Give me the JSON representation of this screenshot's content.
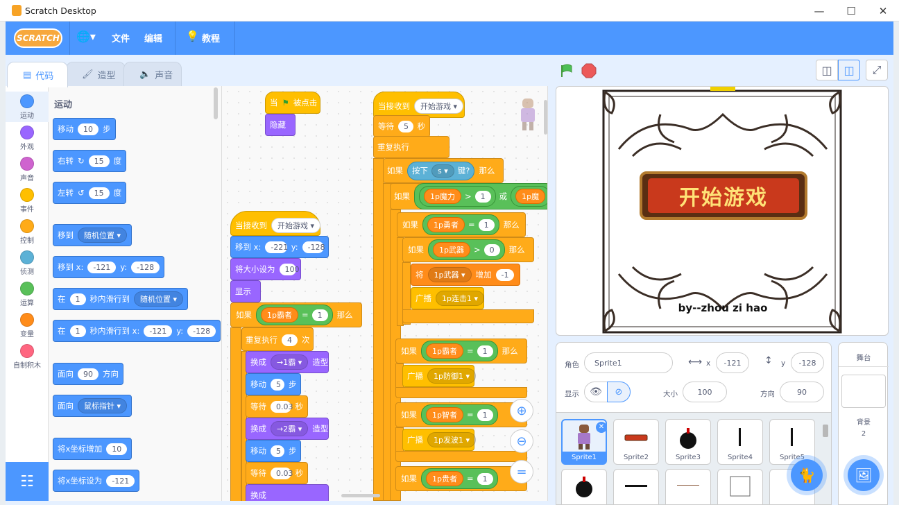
{
  "window": {
    "title": "Scratch Desktop"
  },
  "menu": {
    "logo": "SCRATCH",
    "file": "文件",
    "edit": "编辑",
    "tutorials": "教程"
  },
  "tabs": {
    "code": "代码",
    "costumes": "造型",
    "sounds": "声音"
  },
  "categories": [
    {
      "label": "运动",
      "color": "#4c97ff"
    },
    {
      "label": "外观",
      "color": "#9966ff"
    },
    {
      "label": "声音",
      "color": "#cf63cf"
    },
    {
      "label": "事件",
      "color": "#ffbf00"
    },
    {
      "label": "控制",
      "color": "#ffab19"
    },
    {
      "label": "侦测",
      "color": "#5cb1d6"
    },
    {
      "label": "运算",
      "color": "#59c059"
    },
    {
      "label": "变量",
      "color": "#ff8c1a"
    },
    {
      "label": "自制积木",
      "color": "#ff6680"
    }
  ],
  "palette": {
    "title": "运动",
    "move": {
      "a": "移动",
      "v": "10",
      "b": "步"
    },
    "turn_right": {
      "a": "右转",
      "v": "15",
      "b": "度"
    },
    "turn_left": {
      "a": "左转",
      "v": "15",
      "b": "度"
    },
    "goto": {
      "a": "移到",
      "d": "随机位置"
    },
    "goto_xy": {
      "a": "移到 x:",
      "x": "-121",
      "yl": "y:",
      "y": "-128"
    },
    "glide": {
      "a": "在",
      "v": "1",
      "b": "秒内滑行到",
      "d": "随机位置"
    },
    "glide_xy": {
      "a": "在",
      "v": "1",
      "b": "秒内滑行到 x:",
      "x": "-121",
      "yl": "y:",
      "y": "-128"
    },
    "point_dir": {
      "a": "面向",
      "v": "90",
      "b": "方向"
    },
    "point_towards": {
      "a": "面向",
      "d": "鼠标指针"
    },
    "change_x": {
      "a": "将x坐标增加",
      "v": "10"
    },
    "set_x": {
      "a": "将x坐标设为",
      "v": "-121"
    }
  },
  "script1": {
    "when": "当",
    "clicked": "被点击",
    "hide": "隐藏"
  },
  "script2": {
    "recv": "当接收到",
    "msg": "开始游戏",
    "goto": "移到 x:",
    "x": "-221",
    "yl": "y:",
    "y": "-128",
    "size": "将大小设为",
    "sizev": "100",
    "show": "显示",
    "if": "如果",
    "var": "1p霸者",
    "eq": "=",
    "val": "1",
    "then": "那么",
    "repeat": "重复执行",
    "times": "4",
    "ci": "次",
    "switch": "换成",
    "cost1": "→1霸",
    "cost2": "→2霸",
    "costlbl": "造型",
    "move": "移动",
    "movev": "5",
    "step": "步",
    "wait": "等待",
    "waitv": "0.03",
    "sec": "秒"
  },
  "script3": {
    "recv": "当接收到",
    "msg": "开始游戏",
    "wait": "等待",
    "waitv": "5",
    "sec": "秒",
    "forever": "重复执行",
    "if": "如果",
    "press": "按下",
    "key": "s",
    "keyq": "键?",
    "then": "那么",
    "mp": "1p魔力",
    "gt": ">",
    "one": "1",
    "or": "或",
    "mp2": "1p魔",
    "brave": "1p勇者",
    "eq": "=",
    "weapon": "1p武器",
    "zero": "0",
    "change": "将",
    "add": "增加",
    "neg1": "-1",
    "bcast": "广播",
    "combo": "1p连击1",
    "overlord": "1p霸者",
    "def": "1p防御1",
    "wise": "1p智者",
    "wave": "1p发波1",
    "noble": "1p贵者"
  },
  "stage": {
    "title": "开始游戏",
    "credit": "by--zhou zi hao"
  },
  "sprite_info": {
    "sprite_label": "角色",
    "name": "Sprite1",
    "x_label": "x",
    "x": "-121",
    "y_label": "y",
    "y": "-128",
    "show_label": "显示",
    "size_label": "大小",
    "size": "100",
    "dir_label": "方向",
    "dir": "90"
  },
  "sprites": [
    "Sprite1",
    "Sprite2",
    "Sprite3",
    "Sprite4",
    "Sprite5"
  ],
  "stage_panel": {
    "title": "舞台",
    "bg_label": "背景",
    "bg_count": "2"
  }
}
